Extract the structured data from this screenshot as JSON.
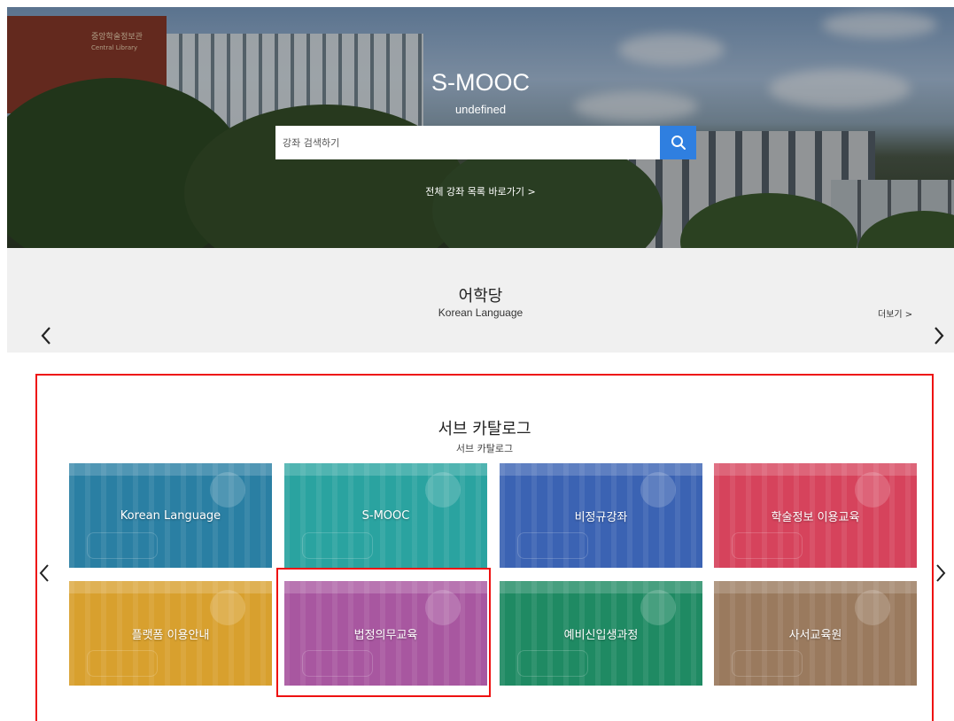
{
  "hero": {
    "title": "S-MOOC",
    "subtitle": "undefined",
    "library_sign_ko": "중앙학술정보관",
    "library_sign_en": "Central Library",
    "search": {
      "placeholder": "강좌 검색하기"
    },
    "all_courses_link": "전체 강좌 목록 바로가기 >"
  },
  "language_section": {
    "title": "어학당",
    "subtitle": "Korean Language",
    "more_link": "더보기 >"
  },
  "sub_catalog": {
    "title": "서브 카탈로그",
    "subtitle": "서브 카탈로그",
    "tiles": [
      {
        "label": "Korean Language",
        "color": "#2a7fa3"
      },
      {
        "label": "S-MOOC",
        "color": "#2aa3a0"
      },
      {
        "label": "비정규강좌",
        "color": "#3b63b3"
      },
      {
        "label": "학술정보 이용교육",
        "color": "#d6435c"
      },
      {
        "label": "플랫폼 이용안내",
        "color": "#d8a02e"
      },
      {
        "label": "법정의무교육",
        "color": "#a857a0"
      },
      {
        "label": "예비신입생과정",
        "color": "#1f8a63"
      },
      {
        "label": "사서교육원",
        "color": "#9a7a5e"
      }
    ]
  },
  "colors": {
    "search_button": "#2f7fe0",
    "highlight": "#e11111",
    "section_bg": "#f0f0f0"
  }
}
